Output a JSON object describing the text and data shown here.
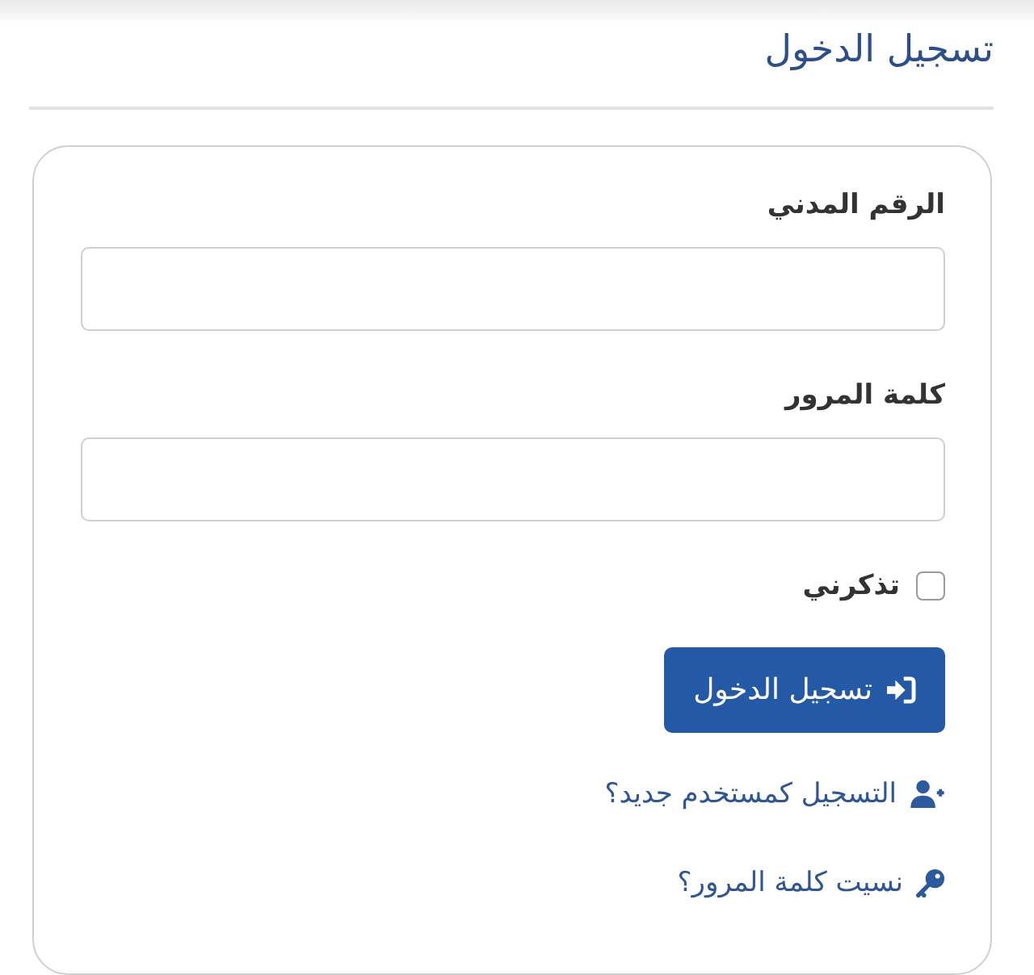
{
  "header": {
    "title": "تسجيل الدخول"
  },
  "form": {
    "fields": [
      {
        "label": "الرقم المدني"
      },
      {
        "label": "كلمة المرور"
      }
    ],
    "remember": {
      "label": "تذكرني",
      "checked": false
    },
    "submit": {
      "label": "تسجيل الدخول"
    },
    "links": [
      {
        "kind": "register",
        "label": "التسجيل كمستخدم جديد؟"
      },
      {
        "kind": "forgot",
        "label": "نسيت كلمة المرور؟"
      }
    ]
  }
}
